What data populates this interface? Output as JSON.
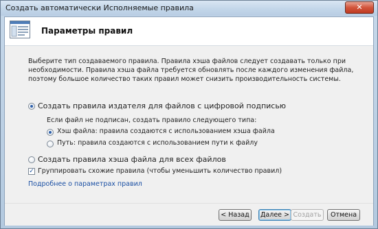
{
  "window": {
    "title": "Создать автоматически Исполняемые правила",
    "close_glyph": "✕"
  },
  "header": {
    "title": "Параметры правил",
    "icon": "wizard-page-icon"
  },
  "description": {
    "line1": "Выберите тип создаваемого правила. Правила хэша файлов следует создавать только при",
    "line2": "необходимости. Правила хэша файла требуется обновлять после каждого изменения файла,",
    "line3": "поэтому большое количество таких правил может снизить производительность системы."
  },
  "options": {
    "publisher": {
      "label": "Создать правила издателя для файлов с цифровой подписью",
      "checked": true
    },
    "unsigned_caption": "Если файл не подписан, создать правило следующего типа:",
    "hash_sub": {
      "label": "Хэш файла: правила создаются с использованием хэша файла",
      "checked": true
    },
    "path_sub": {
      "label": "Путь: правила создаются с использованием пути к файлу",
      "checked": false
    },
    "hash_all": {
      "label": "Создать правила хэша файла для всех файлов",
      "checked": false
    },
    "group": {
      "label": "Группировать схожие правила (чтобы уменьшить количество правил)",
      "checked": true
    }
  },
  "link": {
    "label": "Подробнее о параметрах правил"
  },
  "footer": {
    "back": "< Назад",
    "next": "Далее >",
    "create": "Создать",
    "cancel": "Отмена"
  },
  "colors": {
    "link": "#1a4fa3",
    "titlebar": "#c3d6e9",
    "close_button": "#d2553c",
    "radio_dot": "#2b5ea8"
  }
}
